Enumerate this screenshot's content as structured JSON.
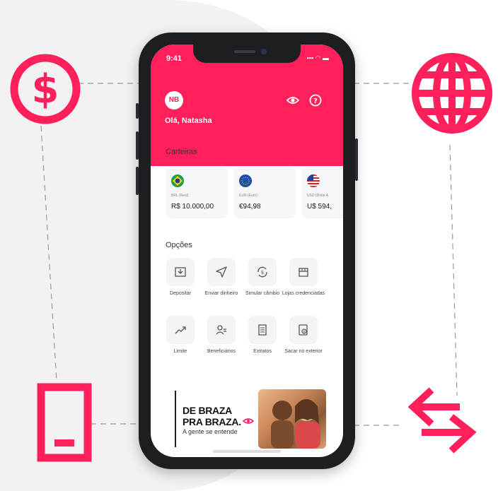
{
  "status_bar": {
    "time": "9:41",
    "icons": "▪▪▪ ◠ ▬"
  },
  "header": {
    "avatar_initials": "NB",
    "greeting": "Olá, Natasha"
  },
  "wallets": {
    "title": "Carteiras",
    "items": [
      {
        "label": "BRL (Real)",
        "value": "R$ 10.000,00",
        "flag": "brazil-flag-icon"
      },
      {
        "label": "EUR (Euro)",
        "value": "€94,98",
        "flag": "eu-flag-icon"
      },
      {
        "label": "USD (Dólar A",
        "value": "U$ 594,",
        "flag": "us-flag-icon"
      }
    ]
  },
  "options": {
    "title": "Opções",
    "items": [
      {
        "label": "Depositar",
        "icon": "deposit-icon"
      },
      {
        "label": "Enviar dinheiro",
        "icon": "send-icon"
      },
      {
        "label": "Simular câmbio",
        "icon": "exchange-icon"
      },
      {
        "label": "Lojas credenciadas",
        "icon": "store-icon"
      },
      {
        "label": "Limite",
        "icon": "trend-icon"
      },
      {
        "label": "Beneficiários",
        "icon": "users-icon"
      },
      {
        "label": "Extratos",
        "icon": "statement-icon"
      },
      {
        "label": "Sacar no exterior",
        "icon": "withdraw-icon"
      }
    ]
  },
  "banner": {
    "line1": "DE BRAZA",
    "line2": "PRA BRAZA.",
    "tagline": "A gente se entende"
  },
  "colors": {
    "brand": "#ff1f5a",
    "phone": "#1d1e22"
  }
}
